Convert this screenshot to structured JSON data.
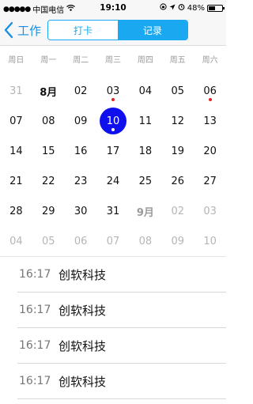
{
  "status_bar": {
    "signal": "●●●●●",
    "carrier": "中国电信",
    "time": "19:10",
    "battery_text": "48%",
    "battery_level": 0.48
  },
  "nav": {
    "back_label": "工作",
    "tabs": [
      {
        "label": "打卡",
        "active": false
      },
      {
        "label": "记录",
        "active": true
      }
    ]
  },
  "calendar": {
    "weekdays": [
      "周日",
      "周一",
      "周二",
      "周三",
      "周四",
      "周五",
      "周六"
    ],
    "weeks": [
      [
        {
          "t": "31",
          "s": "other"
        },
        {
          "t": "8月",
          "s": "bold"
        },
        {
          "t": "02"
        },
        {
          "t": "03",
          "dot": "red"
        },
        {
          "t": "04"
        },
        {
          "t": "05"
        },
        {
          "t": "06",
          "dot": "red"
        }
      ],
      [
        {
          "t": "07"
        },
        {
          "t": "08"
        },
        {
          "t": "09"
        },
        {
          "t": "10",
          "selected": true,
          "dot": "white"
        },
        {
          "t": "11"
        },
        {
          "t": "12"
        },
        {
          "t": "13"
        }
      ],
      [
        {
          "t": "14"
        },
        {
          "t": "15"
        },
        {
          "t": "16"
        },
        {
          "t": "17"
        },
        {
          "t": "18"
        },
        {
          "t": "19"
        },
        {
          "t": "20"
        }
      ],
      [
        {
          "t": "21"
        },
        {
          "t": "22"
        },
        {
          "t": "23"
        },
        {
          "t": "24"
        },
        {
          "t": "25"
        },
        {
          "t": "26"
        },
        {
          "t": "27"
        }
      ],
      [
        {
          "t": "28"
        },
        {
          "t": "29"
        },
        {
          "t": "30"
        },
        {
          "t": "31"
        },
        {
          "t": "9月",
          "s": "month-other"
        },
        {
          "t": "02",
          "s": "other"
        },
        {
          "t": "03",
          "s": "other"
        }
      ],
      [
        {
          "t": "04",
          "s": "other"
        },
        {
          "t": "05",
          "s": "other"
        },
        {
          "t": "06",
          "s": "other"
        },
        {
          "t": "07",
          "s": "other"
        },
        {
          "t": "08",
          "s": "other"
        },
        {
          "t": "09",
          "s": "other"
        },
        {
          "t": "10",
          "s": "other"
        }
      ]
    ],
    "colors": {
      "selected": "#1010ee",
      "dot": "#e52222",
      "accent": "#1aa9f0"
    }
  },
  "records": [
    {
      "time": "16:17",
      "title": "创软科技"
    },
    {
      "time": "16:17",
      "title": "创软科技"
    },
    {
      "time": "16:17",
      "title": "创软科技"
    },
    {
      "time": "16:17",
      "title": "创软科技"
    }
  ]
}
